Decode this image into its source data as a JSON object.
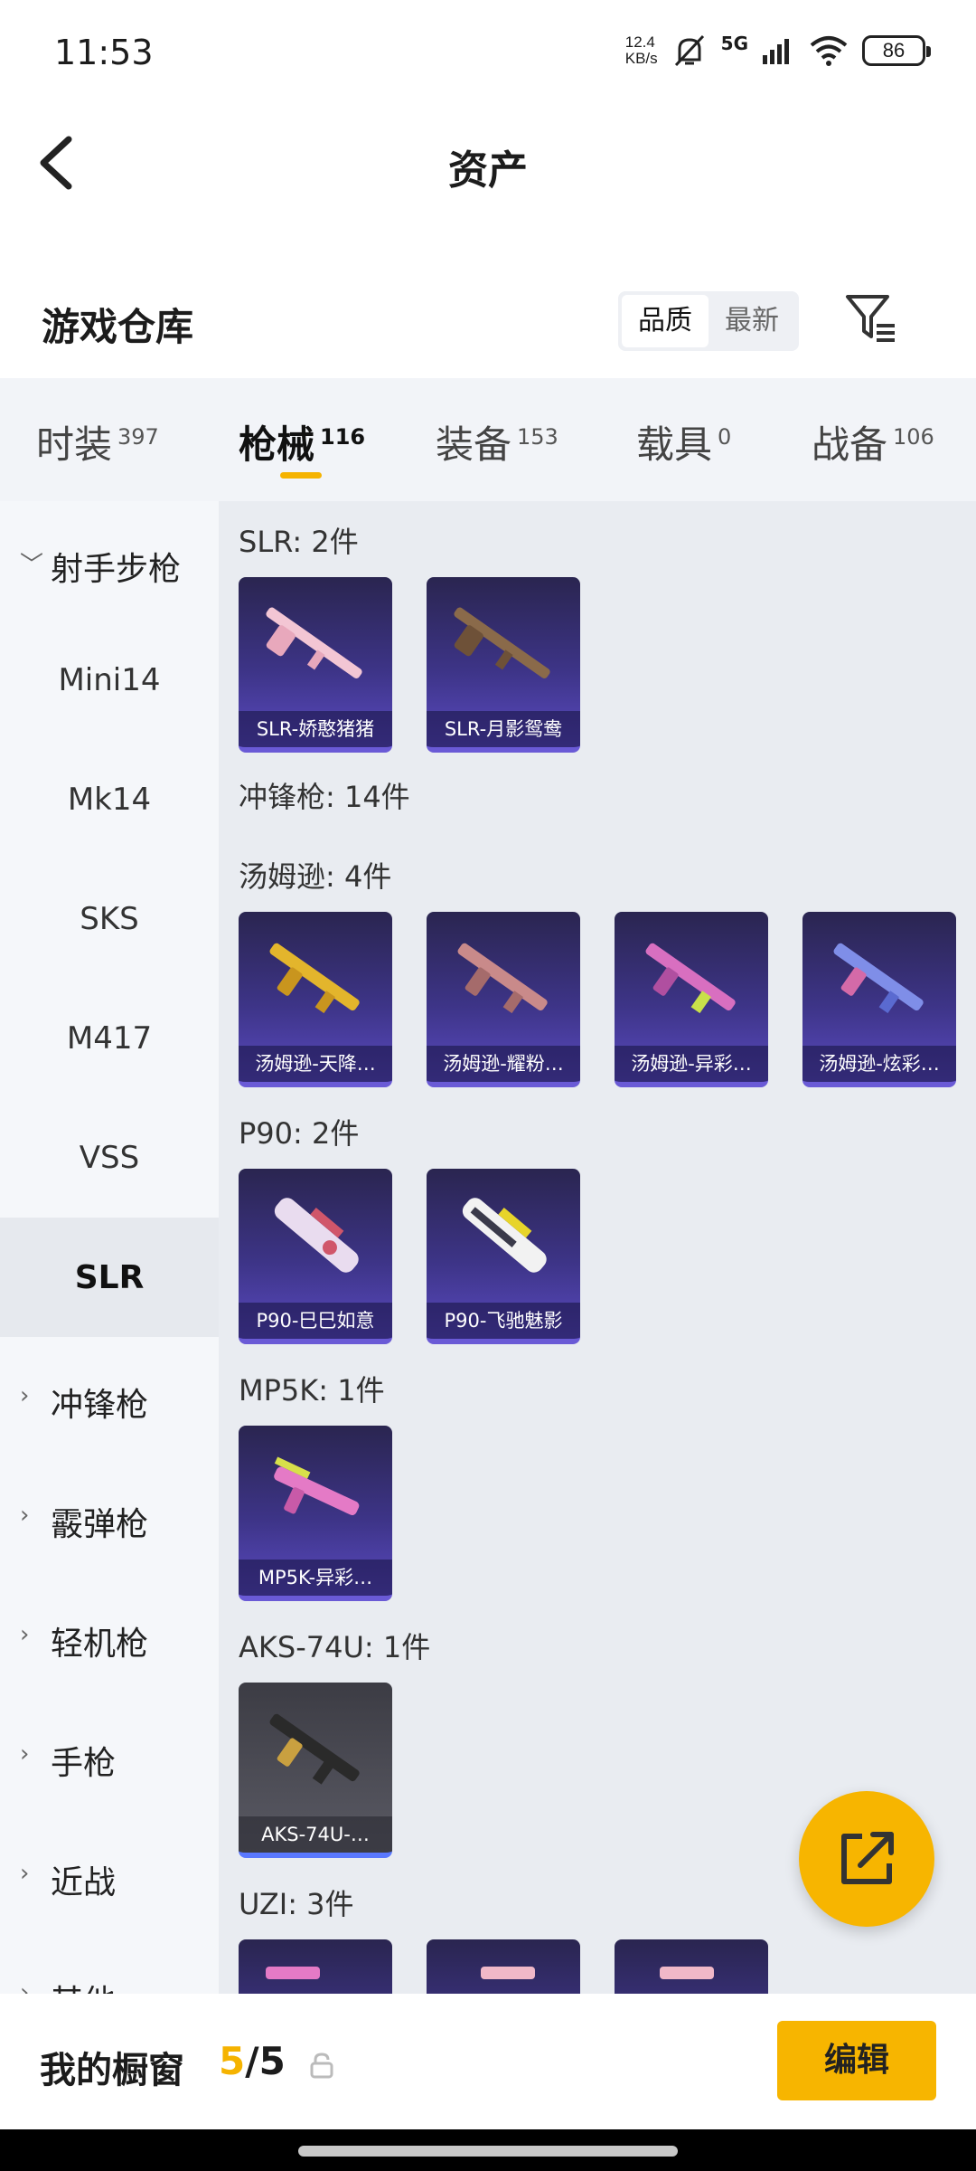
{
  "status_bar": {
    "time": "11:53",
    "net_speed_value": "12.4",
    "net_speed_unit": "KB/s",
    "network": "5G",
    "wifi_sub": "7",
    "battery": "86"
  },
  "header": {
    "title": "资产"
  },
  "warehouse": {
    "title": "游戏仓库",
    "sort_options": [
      "品质",
      "最新"
    ],
    "active_sort": "品质"
  },
  "tabs": [
    {
      "label": "时装",
      "count": "397"
    },
    {
      "label": "枪械",
      "count": "116"
    },
    {
      "label": "装备",
      "count": "153"
    },
    {
      "label": "载具",
      "count": "0"
    },
    {
      "label": "战备",
      "count": "106"
    }
  ],
  "active_tab": "枪械",
  "sidebar": {
    "items": [
      {
        "label": "射手步枪",
        "type": "category",
        "expanded": true
      },
      {
        "label": "Mini14",
        "type": "sub"
      },
      {
        "label": "Mk14",
        "type": "sub"
      },
      {
        "label": "SKS",
        "type": "sub"
      },
      {
        "label": "M417",
        "type": "sub"
      },
      {
        "label": "VSS",
        "type": "sub"
      },
      {
        "label": "SLR",
        "type": "sub",
        "active": true
      },
      {
        "label": "冲锋枪",
        "type": "category"
      },
      {
        "label": "霰弹枪",
        "type": "category"
      },
      {
        "label": "轻机枪",
        "type": "category"
      },
      {
        "label": "手枪",
        "type": "category"
      },
      {
        "label": "近战",
        "type": "category"
      },
      {
        "label": "其他",
        "type": "category"
      }
    ]
  },
  "content": {
    "sections": [
      {
        "title": "SLR: 2件",
        "items": [
          "SLR-娇憨猪猪",
          "SLR-月影鸳鸯"
        ]
      },
      {
        "title": "冲锋枪: 14件",
        "items": []
      },
      {
        "title": "汤姆逊: 4件",
        "items": [
          "汤姆逊-天降…",
          "汤姆逊-耀粉…",
          "汤姆逊-异彩…",
          "汤姆逊-炫彩…"
        ]
      },
      {
        "title": "P90: 2件",
        "items": [
          "P90-巳巳如意",
          "P90-飞驰魅影"
        ]
      },
      {
        "title": "MP5K: 1件",
        "items": [
          "MP5K-异彩…"
        ]
      },
      {
        "title": "AKS-74U: 1件",
        "items": [
          "AKS-74U-…"
        ]
      },
      {
        "title": "UZI: 3件",
        "items": [
          "",
          "",
          ""
        ]
      }
    ]
  },
  "bottom_bar": {
    "label": "我的橱窗",
    "current": "5",
    "separator": "/",
    "total": "5",
    "edit_label": "编辑"
  },
  "colors": {
    "accent": "#f7b500",
    "card_purple": "#3d3487",
    "card_gray": "#5a5a64"
  }
}
